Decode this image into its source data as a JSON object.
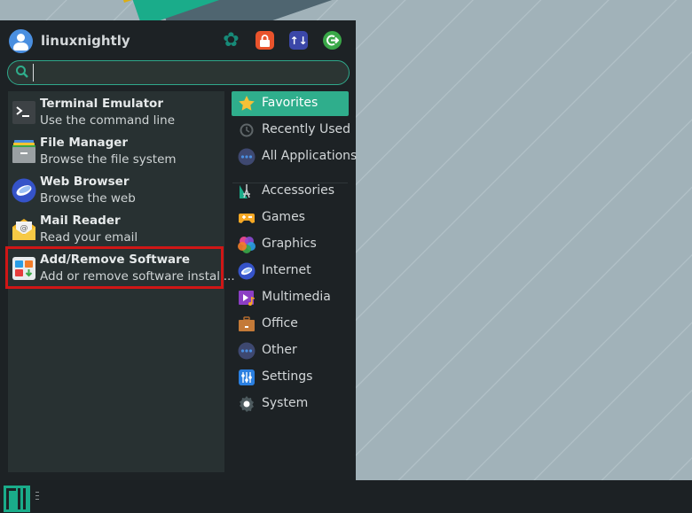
{
  "user": {
    "name": "linuxnightly"
  },
  "header_actions": [
    {
      "name": "settings",
      "icon": "settings-wrench-icon",
      "color": "#178a78"
    },
    {
      "name": "lock",
      "icon": "lock-icon",
      "color": "#e9532c"
    },
    {
      "name": "switch-user",
      "icon": "switch-user-icon",
      "color": "#3b47a8"
    },
    {
      "name": "logout",
      "icon": "logout-icon",
      "color": "#3aa848"
    }
  ],
  "search": {
    "value": "",
    "placeholder": ""
  },
  "favorites": [
    {
      "name": "Terminal Emulator",
      "desc": "Use the command line",
      "icon": "terminal-icon"
    },
    {
      "name": "File Manager",
      "desc": "Browse the file system",
      "icon": "file-manager-icon"
    },
    {
      "name": "Web Browser",
      "desc": "Browse the web",
      "icon": "web-browser-icon"
    },
    {
      "name": "Mail Reader",
      "desc": "Read your email",
      "icon": "mail-icon"
    },
    {
      "name": "Add/Remove Software",
      "desc": "Add or remove software install...",
      "icon": "software-icon",
      "highlighted": true
    }
  ],
  "categories": [
    {
      "label": "Favorites",
      "icon": "star-icon",
      "active": true
    },
    {
      "label": "Recently Used",
      "icon": "clock-icon"
    },
    {
      "label": "All Applications",
      "icon": "dots-icon"
    },
    {
      "label": "Accessories",
      "icon": "accessories-icon"
    },
    {
      "label": "Games",
      "icon": "gamepad-icon"
    },
    {
      "label": "Graphics",
      "icon": "graphics-icon"
    },
    {
      "label": "Internet",
      "icon": "internet-icon"
    },
    {
      "label": "Multimedia",
      "icon": "multimedia-icon"
    },
    {
      "label": "Office",
      "icon": "briefcase-icon"
    },
    {
      "label": "Other",
      "icon": "dots-icon"
    },
    {
      "label": "Settings",
      "icon": "settings-sliders-icon"
    },
    {
      "label": "System",
      "icon": "gear-icon"
    }
  ],
  "colors": {
    "accent": "#2fae8c",
    "highlight_border": "#d01616",
    "menu_bg": "#1d2225",
    "pane_bg": "#283132"
  }
}
